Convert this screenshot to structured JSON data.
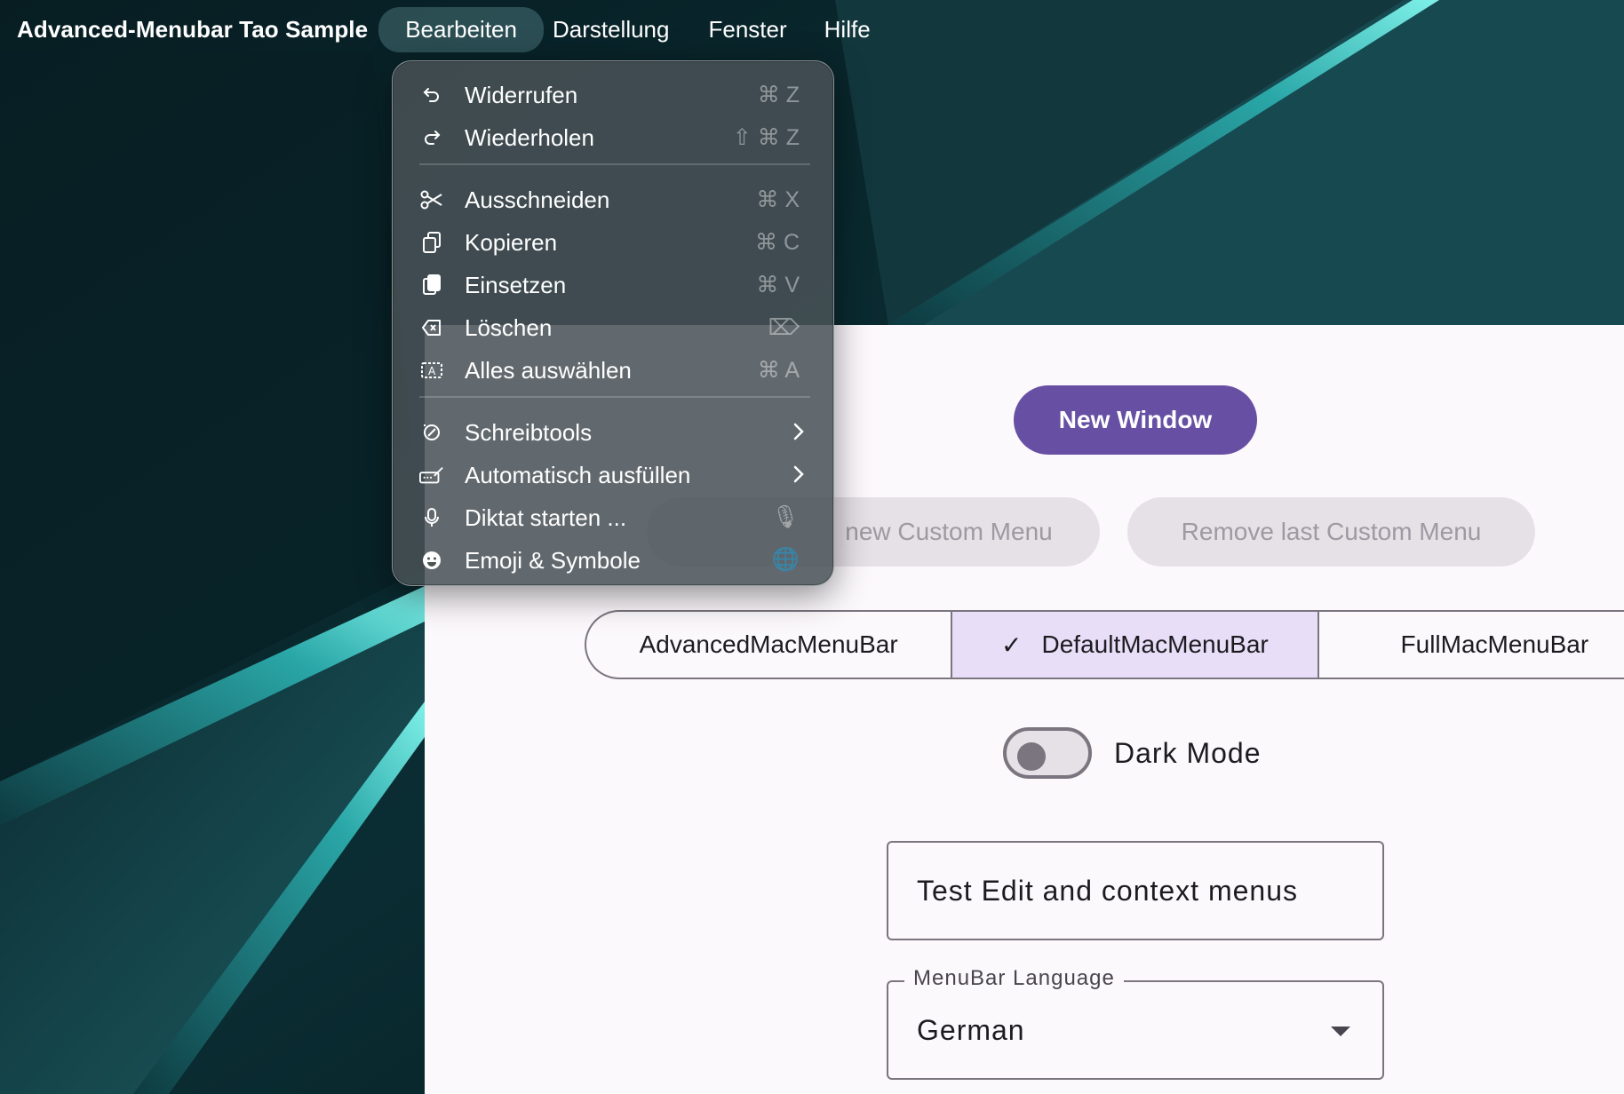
{
  "menubar": {
    "app_name": "Advanced-Menubar Tao Sample",
    "menus": [
      "Bearbeiten",
      "Darstellung",
      "Fenster",
      "Hilfe"
    ],
    "active_menu": "Bearbeiten"
  },
  "edit_menu": {
    "items": [
      {
        "label": "Widerrufen",
        "shortcut": "⌘ Z",
        "icon": "undo-icon"
      },
      {
        "label": "Wiederholen",
        "shortcut": "⇧ ⌘ Z",
        "icon": "redo-icon"
      },
      {
        "label": "Ausschneiden",
        "shortcut": "⌘ X",
        "icon": "scissors-icon"
      },
      {
        "label": "Kopieren",
        "shortcut": "⌘ C",
        "icon": "copy-icon"
      },
      {
        "label": "Einsetzen",
        "shortcut": "⌘ V",
        "icon": "paste-icon"
      },
      {
        "label": "Löschen",
        "shortcut": "⌦",
        "icon": "delete-icon"
      },
      {
        "label": "Alles auswählen",
        "shortcut": "⌘ A",
        "icon": "select-all-icon"
      },
      {
        "label": "Schreibtools",
        "icon": "writing-tools-icon",
        "submenu": true
      },
      {
        "label": "Automatisch ausfüllen",
        "icon": "autofill-icon",
        "submenu": true
      },
      {
        "label": "Diktat starten ...",
        "shortcut": "🎙",
        "icon": "microphone-icon"
      },
      {
        "label": "Emoji & Symbole",
        "shortcut": "🌐",
        "icon": "emoji-icon"
      }
    ]
  },
  "app": {
    "new_window_button": "New Window",
    "add_custom_menu_button": "new Custom Menu",
    "remove_custom_menu_button": "Remove last Custom Menu",
    "segments": [
      "AdvancedMacMenuBar",
      "DefaultMacMenuBar",
      "FullMacMenuBar"
    ],
    "selected_segment": "DefaultMacMenuBar",
    "dark_mode_label": "Dark Mode",
    "dark_mode_on": false,
    "text_field_value": "Test Edit and context menus",
    "language_select": {
      "label": "MenuBar Language",
      "value": "German"
    }
  },
  "colors": {
    "primary": "#6750a4",
    "segment_selected": "#e8def8",
    "window_background": "#fcf9fc",
    "wallpaper_teal": "#3ec6c4"
  }
}
